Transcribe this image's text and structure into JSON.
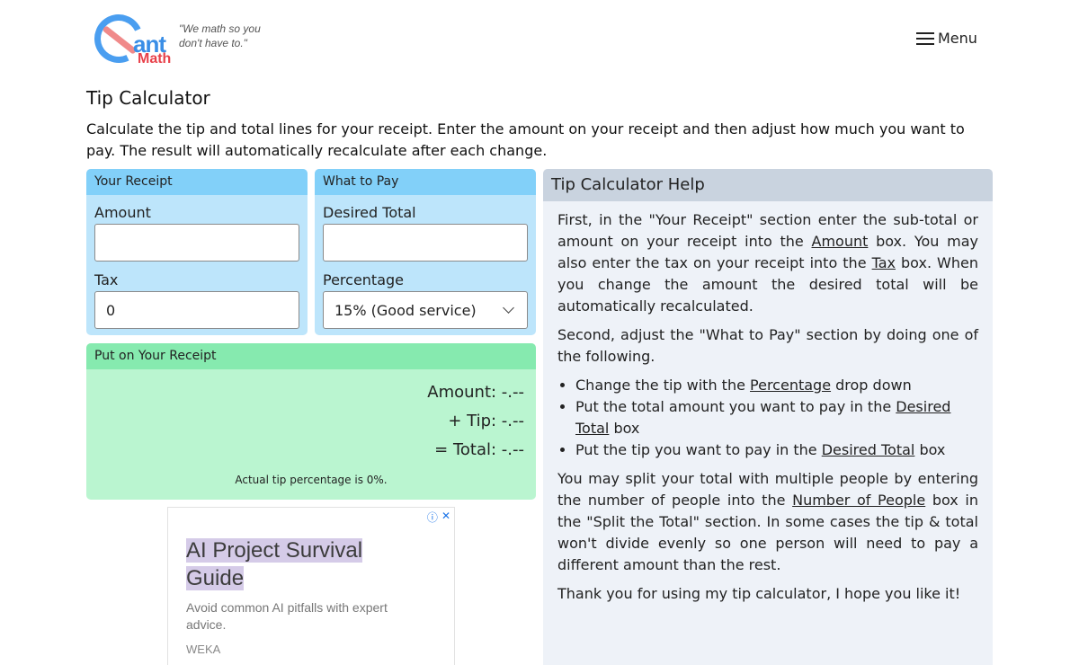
{
  "header": {
    "logo": {
      "part1": "ant",
      "part2": "Math"
    },
    "tagline": "\"We math so you don't have to.\"",
    "menu_label": "Menu"
  },
  "page": {
    "title": "Tip Calculator",
    "intro": "Calculate the tip and total lines for your receipt. Enter the amount on your receipt and then adjust how much you want to pay. The result will automatically recalculate after each change."
  },
  "receipt": {
    "heading": "Your Receipt",
    "amount_label": "Amount",
    "amount_value": "",
    "tax_label": "Tax",
    "tax_value": "0"
  },
  "to_pay": {
    "heading": "What to Pay",
    "desired_total_label": "Desired Total",
    "desired_total_value": "",
    "percentage_label": "Percentage",
    "percentage_selected": "15% (Good service)"
  },
  "result": {
    "heading": "Put on Your Receipt",
    "amount_line": "Amount: -.--",
    "tip_line": "+ Tip: -.--",
    "total_line": "= Total: -.--",
    "note": "Actual tip percentage is 0%."
  },
  "ad": {
    "title": "AI Project Survival Guide",
    "description": "Avoid common AI pitfalls with expert advice.",
    "brand": "WEKA",
    "info_glyph": "ⓘ",
    "close_glyph": "✕"
  },
  "help": {
    "heading": "Tip Calculator Help",
    "p1_a": "First, in the \"Your Receipt\" section enter the sub-total or amount on your receipt into the ",
    "p1_link1": "Amount",
    "p1_b": " box. You may also enter the tax on your receipt into the ",
    "p1_link2": "Tax",
    "p1_c": " box. When you change the amount the desired total will be automatically recalculated.",
    "p2": "Second, adjust the \"What to Pay\" section by doing one of the following.",
    "li1_a": "Change the tip with the ",
    "li1_link": "Percentage",
    "li1_b": " drop down",
    "li2_a": "Put the total amount you want to pay in the ",
    "li2_link": "Desired Total",
    "li2_b": " box",
    "li3_a": "Put the tip you want to pay in the ",
    "li3_link": "Desired Total",
    "li3_b": " box",
    "p3_a": "You may split your total with multiple people by entering the number of people into the ",
    "p3_link": "Number of People",
    "p3_b": " box in the \"Split the Total\" section. In some cases the tip & total won't divide evenly so one person will need to pay a different amount than the rest.",
    "p4": "Thank you for using my tip calculator, I hope you like it!"
  }
}
